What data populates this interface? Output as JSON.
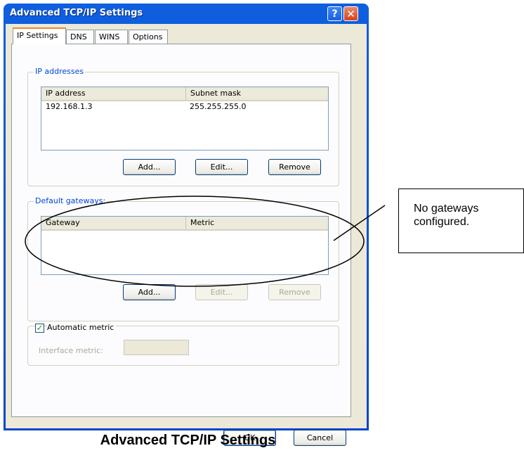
{
  "window": {
    "title": "Advanced TCP/IP Settings",
    "help_icon": "?",
    "close_icon": "✕"
  },
  "tabs": [
    "IP Settings",
    "DNS",
    "WINS",
    "Options"
  ],
  "ip_addresses": {
    "group_label": "IP addresses",
    "columns": [
      "IP address",
      "Subnet mask"
    ],
    "rows": [
      [
        "192.168.1.3",
        "255.255.255.0"
      ]
    ],
    "buttons": {
      "add": "Add...",
      "edit": "Edit...",
      "remove": "Remove"
    }
  },
  "default_gateways": {
    "group_label": "Default gateways:",
    "columns": [
      "Gateway",
      "Metric"
    ],
    "rows": [],
    "buttons": {
      "add": "Add...",
      "edit": "Edit...",
      "remove": "Remove"
    }
  },
  "automatic_metric": {
    "label": "Automatic metric",
    "checked": true,
    "interface_metric_label": "Interface metric:",
    "interface_metric_value": ""
  },
  "dialog_buttons": {
    "ok": "OK",
    "cancel": "Cancel"
  },
  "annotation": {
    "text": "No gateways configured."
  },
  "caption": "Advanced TCP/IP Settings"
}
